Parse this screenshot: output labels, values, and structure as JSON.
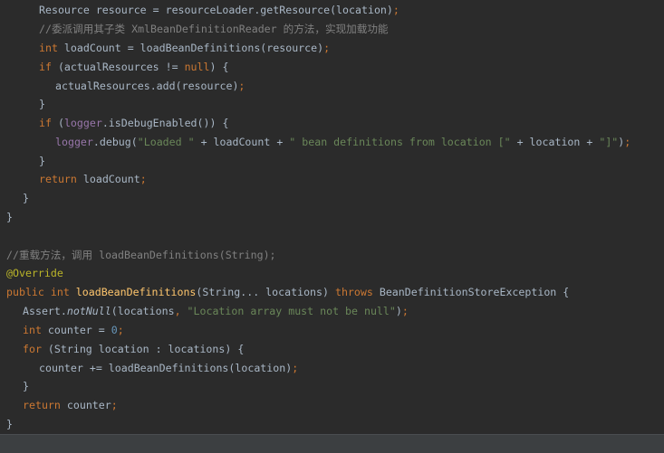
{
  "editor": {
    "lines": [
      {
        "segments": [
          {
            "text": "Resource resource = resourceLoader.getResource(location)",
            "cls": ""
          },
          {
            "text": ";",
            "cls": "kw"
          }
        ]
      },
      {
        "segments": [
          {
            "text": "//委派调用其子类 XmlBeanDefinitionReader 的方法，实现加载功能",
            "cls": "cmt"
          }
        ]
      },
      {
        "segments": [
          {
            "text": "int ",
            "cls": "kw"
          },
          {
            "text": "loadCount = loadBeanDefinitions(resource)",
            "cls": ""
          },
          {
            "text": ";",
            "cls": "kw"
          }
        ]
      },
      {
        "segments": [
          {
            "text": "if ",
            "cls": "kw"
          },
          {
            "text": "(actualResources != ",
            "cls": ""
          },
          {
            "text": "null",
            "cls": "kw"
          },
          {
            "text": ") {",
            "cls": ""
          }
        ]
      },
      {
        "segments": [
          {
            "text": "actualResources.add(resource)",
            "cls": ""
          },
          {
            "text": ";",
            "cls": "kw"
          }
        ]
      },
      {
        "segments": [
          {
            "text": "}",
            "cls": ""
          }
        ]
      },
      {
        "segments": [
          {
            "text": "if ",
            "cls": "kw"
          },
          {
            "text": "(",
            "cls": ""
          },
          {
            "text": "logger",
            "cls": "fld"
          },
          {
            "text": ".isDebugEnabled()) {",
            "cls": ""
          }
        ]
      },
      {
        "segments": [
          {
            "text": "logger",
            "cls": "fld"
          },
          {
            "text": ".debug(",
            "cls": ""
          },
          {
            "text": "\"Loaded \"",
            "cls": "str"
          },
          {
            "text": " + loadCount + ",
            "cls": ""
          },
          {
            "text": "\" bean definitions from location [\"",
            "cls": "str"
          },
          {
            "text": " + location + ",
            "cls": ""
          },
          {
            "text": "\"]\"",
            "cls": "str"
          },
          {
            "text": ")",
            "cls": ""
          },
          {
            "text": ";",
            "cls": "kw"
          }
        ]
      },
      {
        "segments": [
          {
            "text": "}",
            "cls": ""
          }
        ]
      },
      {
        "segments": [
          {
            "text": "return ",
            "cls": "kw"
          },
          {
            "text": "loadCount",
            "cls": ""
          },
          {
            "text": ";",
            "cls": "kw"
          }
        ]
      },
      {
        "segments": [
          {
            "text": "}",
            "cls": ""
          }
        ]
      },
      {
        "segments": [
          {
            "text": "}",
            "cls": ""
          }
        ]
      },
      {
        "segments": []
      },
      {
        "segments": [
          {
            "text": "//重载方法，调用 loadBeanDefinitions(String);",
            "cls": "cmt"
          }
        ]
      },
      {
        "segments": [
          {
            "text": "@Override",
            "cls": "ann"
          }
        ]
      },
      {
        "segments": [
          {
            "text": "public int ",
            "cls": "kw"
          },
          {
            "text": "loadBeanDefinitions",
            "cls": "mth"
          },
          {
            "text": "(String... locations) ",
            "cls": ""
          },
          {
            "text": "throws ",
            "cls": "kw"
          },
          {
            "text": "BeanDefinitionStoreException {",
            "cls": ""
          }
        ]
      },
      {
        "segments": [
          {
            "text": "Assert.",
            "cls": ""
          },
          {
            "text": "notNull",
            "cls": "ital"
          },
          {
            "text": "(locations",
            "cls": ""
          },
          {
            "text": ", ",
            "cls": "kw"
          },
          {
            "text": "\"Location array must not be null\"",
            "cls": "str"
          },
          {
            "text": ")",
            "cls": ""
          },
          {
            "text": ";",
            "cls": "kw"
          }
        ]
      },
      {
        "segments": [
          {
            "text": "int ",
            "cls": "kw"
          },
          {
            "text": "counter = ",
            "cls": ""
          },
          {
            "text": "0",
            "cls": "num"
          },
          {
            "text": ";",
            "cls": "kw"
          }
        ]
      },
      {
        "segments": [
          {
            "text": "for ",
            "cls": "kw"
          },
          {
            "text": "(String location : locations) {",
            "cls": ""
          }
        ]
      },
      {
        "segments": [
          {
            "text": "counter += loadBeanDefinitions(location)",
            "cls": ""
          },
          {
            "text": ";",
            "cls": "kw"
          }
        ]
      },
      {
        "segments": [
          {
            "text": "}",
            "cls": ""
          }
        ]
      },
      {
        "segments": [
          {
            "text": "return ",
            "cls": "kw"
          },
          {
            "text": "counter",
            "cls": ""
          },
          {
            "text": ";",
            "cls": "kw"
          }
        ]
      },
      {
        "segments": [
          {
            "text": "}",
            "cls": ""
          }
        ]
      }
    ]
  }
}
